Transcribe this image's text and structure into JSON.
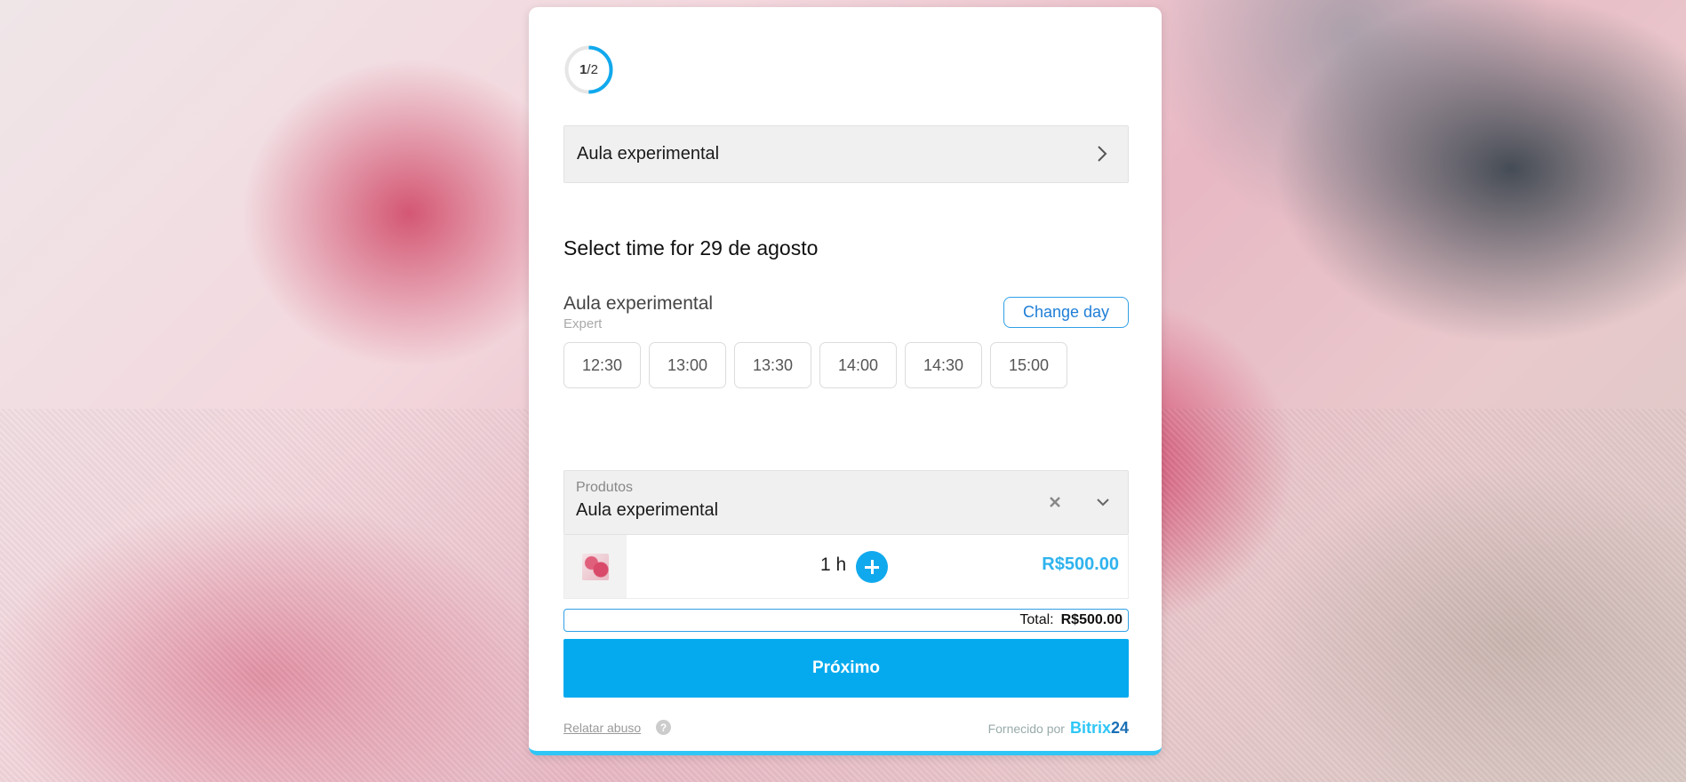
{
  "progress": {
    "current": "1",
    "total": "2",
    "fraction": 0.5,
    "color": "#11a9ed"
  },
  "service": {
    "selected": "Aula experimental"
  },
  "schedule": {
    "title": "Select time for 29 de agosto",
    "service_name": "Aula experimental",
    "resource": "Expert",
    "change_day_label": "Change day",
    "slots": [
      "12:30",
      "13:00",
      "13:30",
      "14:00",
      "14:30",
      "15:00"
    ]
  },
  "products": {
    "label": "Produtos",
    "value": "Aula experimental",
    "clear_icon": "close-icon",
    "dropdown_icon": "chevron-down-icon",
    "quantity": "1 h",
    "price": "R$500.00"
  },
  "total": {
    "label": "Total:",
    "value": "R$500.00"
  },
  "next_button": "Próximo",
  "footer": {
    "report": "Relatar abuso",
    "help": "?",
    "powered_by": "Fornecido por",
    "brand": "Bitrix",
    "brand_num": "24"
  },
  "colors": {
    "accent": "#05aaee",
    "link": "#1e7ed6",
    "price": "#2fb3ee"
  }
}
